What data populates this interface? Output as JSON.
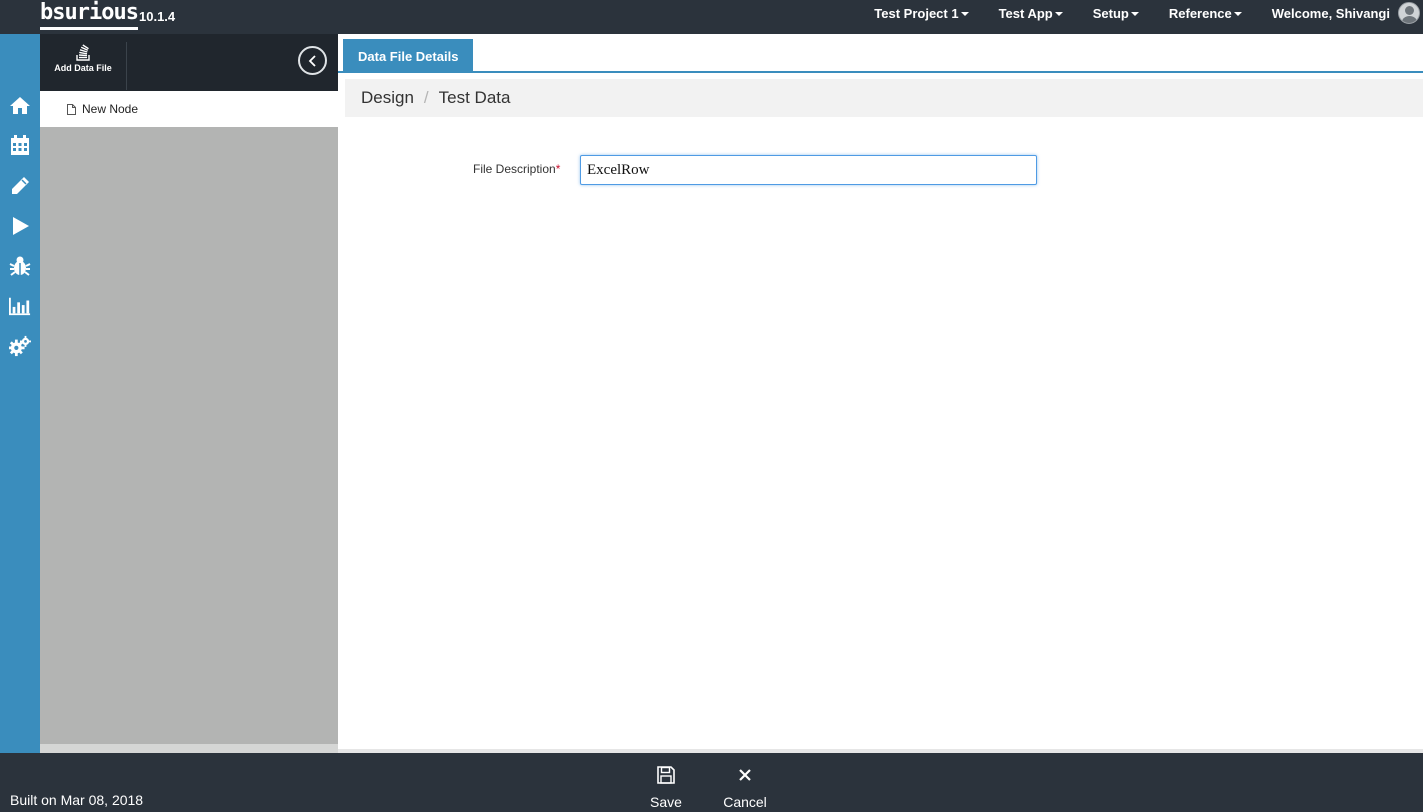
{
  "topbar": {
    "logo": "bsurious",
    "version": "10.1.4",
    "nav": [
      {
        "label": "Test Project 1"
      },
      {
        "label": "Test App"
      },
      {
        "label": "Setup"
      },
      {
        "label": "Reference"
      }
    ],
    "welcome": "Welcome, Shivangi"
  },
  "rail": {
    "icons": [
      "home-icon",
      "calendar-icon",
      "pencil-icon",
      "play-icon",
      "bug-icon",
      "bar-chart-icon",
      "cogs-icon"
    ]
  },
  "tree": {
    "add_label": "Add Data File",
    "node_label": "New Node"
  },
  "main": {
    "tab_label": "Data File Details",
    "breadcrumb": [
      "Design",
      "Test Data"
    ],
    "breadcrumb_separator": "/",
    "form": {
      "label": "File Description",
      "required_mark": "*",
      "value": "ExcelRow"
    }
  },
  "footer": {
    "built": "Built on Mar 08, 2018",
    "save_label": "Save",
    "cancel_label": "Cancel"
  },
  "colors": {
    "topbar": "#2b333c",
    "accent": "#3a8dbd",
    "tree_bg": "#b3b4b3"
  }
}
